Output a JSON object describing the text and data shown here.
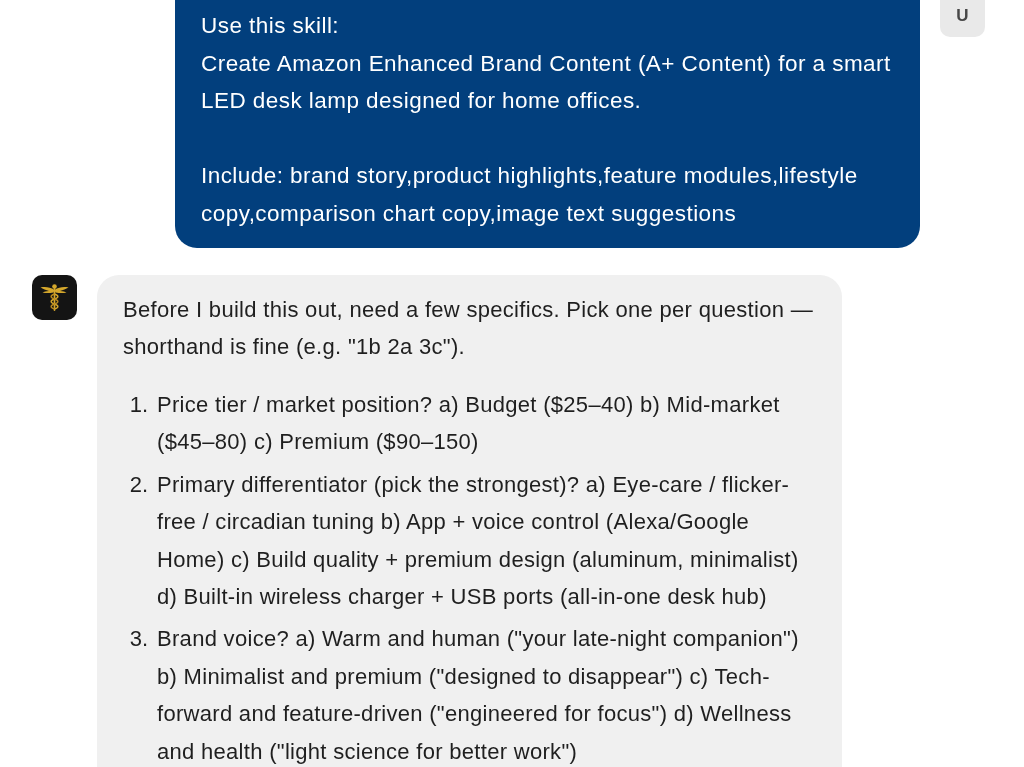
{
  "messages": [
    {
      "kind": "user",
      "avatar": "U",
      "text": "Use this skill:\nCreate Amazon Enhanced Brand Content (A+ Content) for a smart LED desk lamp designed for home offices.\n\nInclude: brand story,product highlights,feature modules,lifestyle copy,comparison chart copy,image text suggestions"
    },
    {
      "kind": "assistant",
      "intro": "Before I build this out, need a few specifics. Pick one per question — shorthand is fine (e.g. \"1b 2a 3c\").",
      "questions": [
        {
          "number": "1.",
          "text": "Price tier / market position? a) Budget ($25–40) b) Mid-market ($45–80) c) Premium ($90–150)"
        },
        {
          "number": "2.",
          "text": "Primary differentiator (pick the strongest)? a) Eye-care / flicker-free / circadian tuning b) App + voice control (Alexa/Google Home) c) Build quality + premium design (aluminum, minimalist) d) Built-in wireless charger + USB ports (all-in-one desk hub)"
        },
        {
          "number": "3.",
          "text": "Brand voice? a) Warm and human (\"your late-night companion\") b) Minimalist and premium (\"designed to disappear\") c) Tech-forward and feature-driven (\"engineered for focus\") d) Wellness and health (\"light science for better work\")"
        }
      ]
    }
  ]
}
